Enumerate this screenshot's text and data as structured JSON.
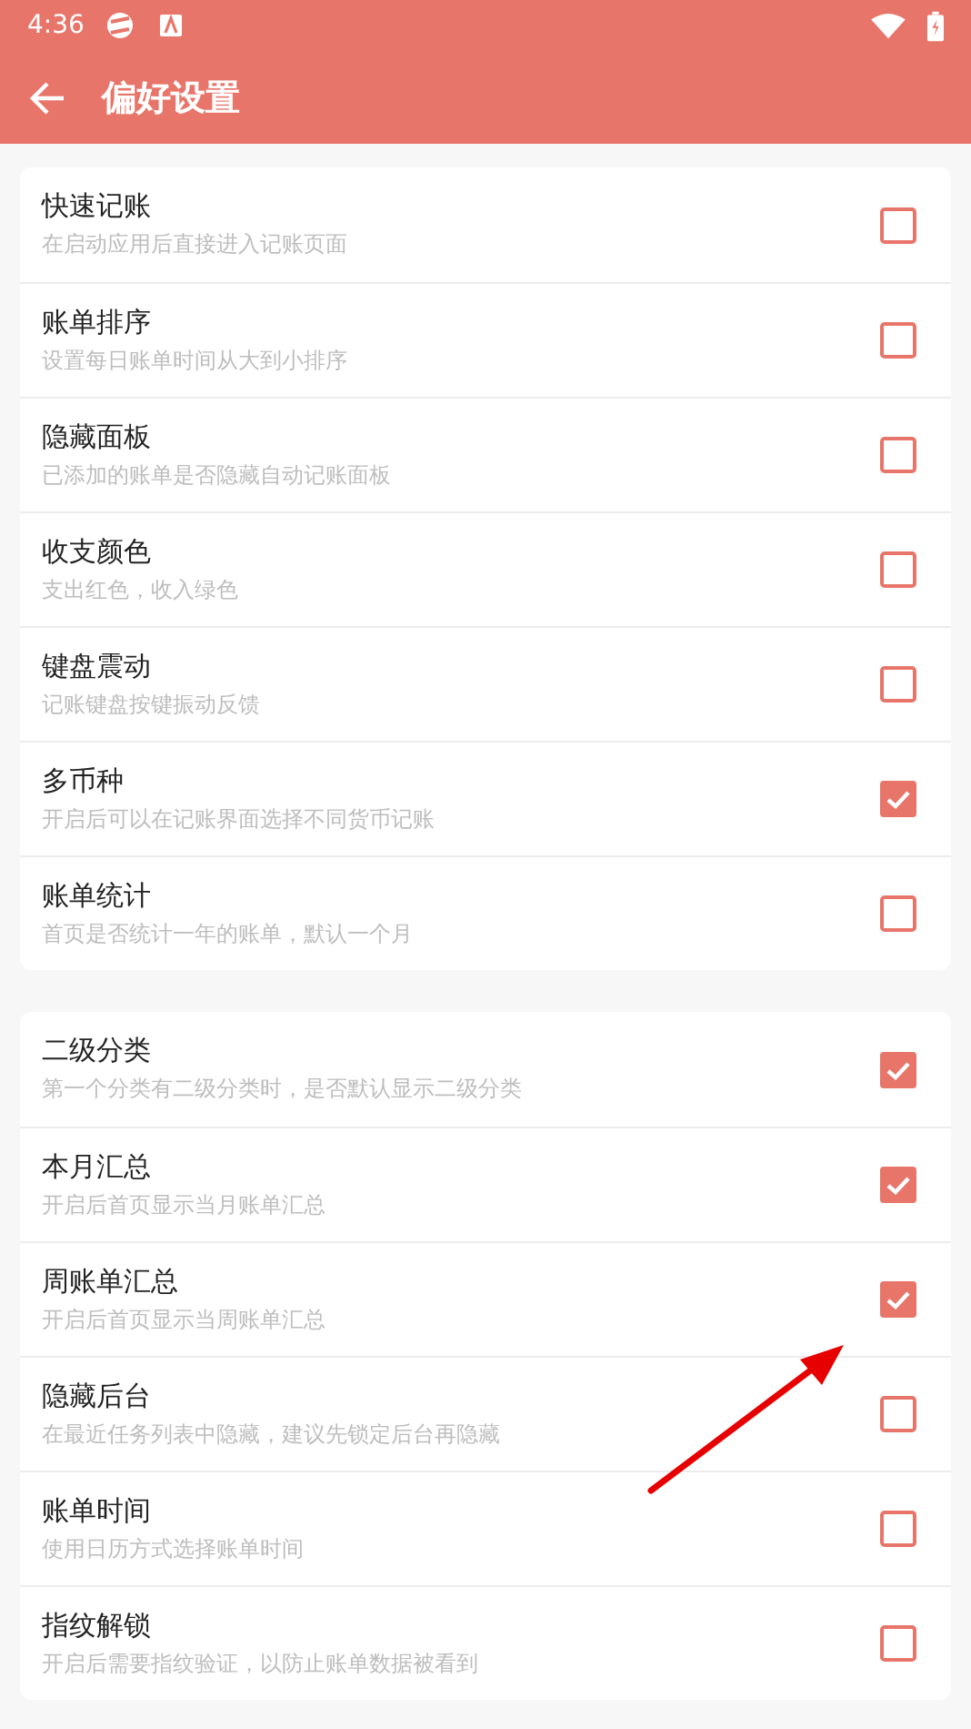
{
  "status_bar": {
    "time": "4:36"
  },
  "toolbar": {
    "title": "偏好设置"
  },
  "sections": [
    {
      "items": [
        {
          "title": "快速记账",
          "subtitle": "在启动应用后直接进入记账页面",
          "checked": false
        },
        {
          "title": "账单排序",
          "subtitle": "设置每日账单时间从大到小排序",
          "checked": false
        },
        {
          "title": "隐藏面板",
          "subtitle": "已添加的账单是否隐藏自动记账面板",
          "checked": false
        },
        {
          "title": "收支颜色",
          "subtitle": "支出红色，收入绿色",
          "checked": false
        },
        {
          "title": "键盘震动",
          "subtitle": "记账键盘按键振动反馈",
          "checked": false
        },
        {
          "title": "多币种",
          "subtitle": "开启后可以在记账界面选择不同货币记账",
          "checked": true
        },
        {
          "title": "账单统计",
          "subtitle": "首页是否统计一年的账单，默认一个月",
          "checked": false
        }
      ]
    },
    {
      "items": [
        {
          "title": "二级分类",
          "subtitle": "第一个分类有二级分类时，是否默认显示二级分类",
          "checked": true
        },
        {
          "title": "本月汇总",
          "subtitle": "开启后首页显示当月账单汇总",
          "checked": true
        },
        {
          "title": "周账单汇总",
          "subtitle": "开启后首页显示当周账单汇总",
          "checked": true
        },
        {
          "title": "隐藏后台",
          "subtitle": "在最近任务列表中隐藏，建议先锁定后台再隐藏",
          "checked": false
        },
        {
          "title": "账单时间",
          "subtitle": "使用日历方式选择账单时间",
          "checked": false
        },
        {
          "title": "指纹解锁",
          "subtitle": "开启后需要指纹验证，以防止账单数据被看到",
          "checked": false
        }
      ]
    }
  ]
}
